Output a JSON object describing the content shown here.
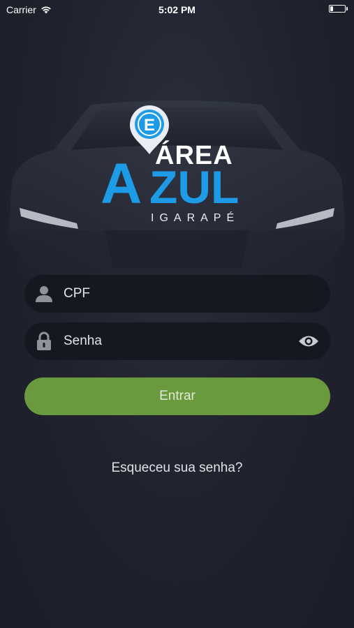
{
  "status_bar": {
    "carrier": "Carrier",
    "time": "5:02 PM",
    "battery_level": 0.2
  },
  "logo": {
    "marker_letter": "E",
    "line1": "ÁREA",
    "big_letter": "A",
    "line2": "ZUL",
    "line3": "IGARAPÉ",
    "brand_color": "#1e9be6"
  },
  "form": {
    "cpf_placeholder": "CPF",
    "password_placeholder": "Senha",
    "submit_label": "Entrar",
    "forgot_label": "Esqueceu sua senha?"
  },
  "icons": {
    "cpf": "user-icon",
    "password": "lock-icon",
    "toggle": "eye-icon",
    "wifi": "wifi-icon",
    "battery": "battery-icon"
  },
  "colors": {
    "background": "#1f222d",
    "field": "#161821",
    "button": "#6a9a3d"
  }
}
